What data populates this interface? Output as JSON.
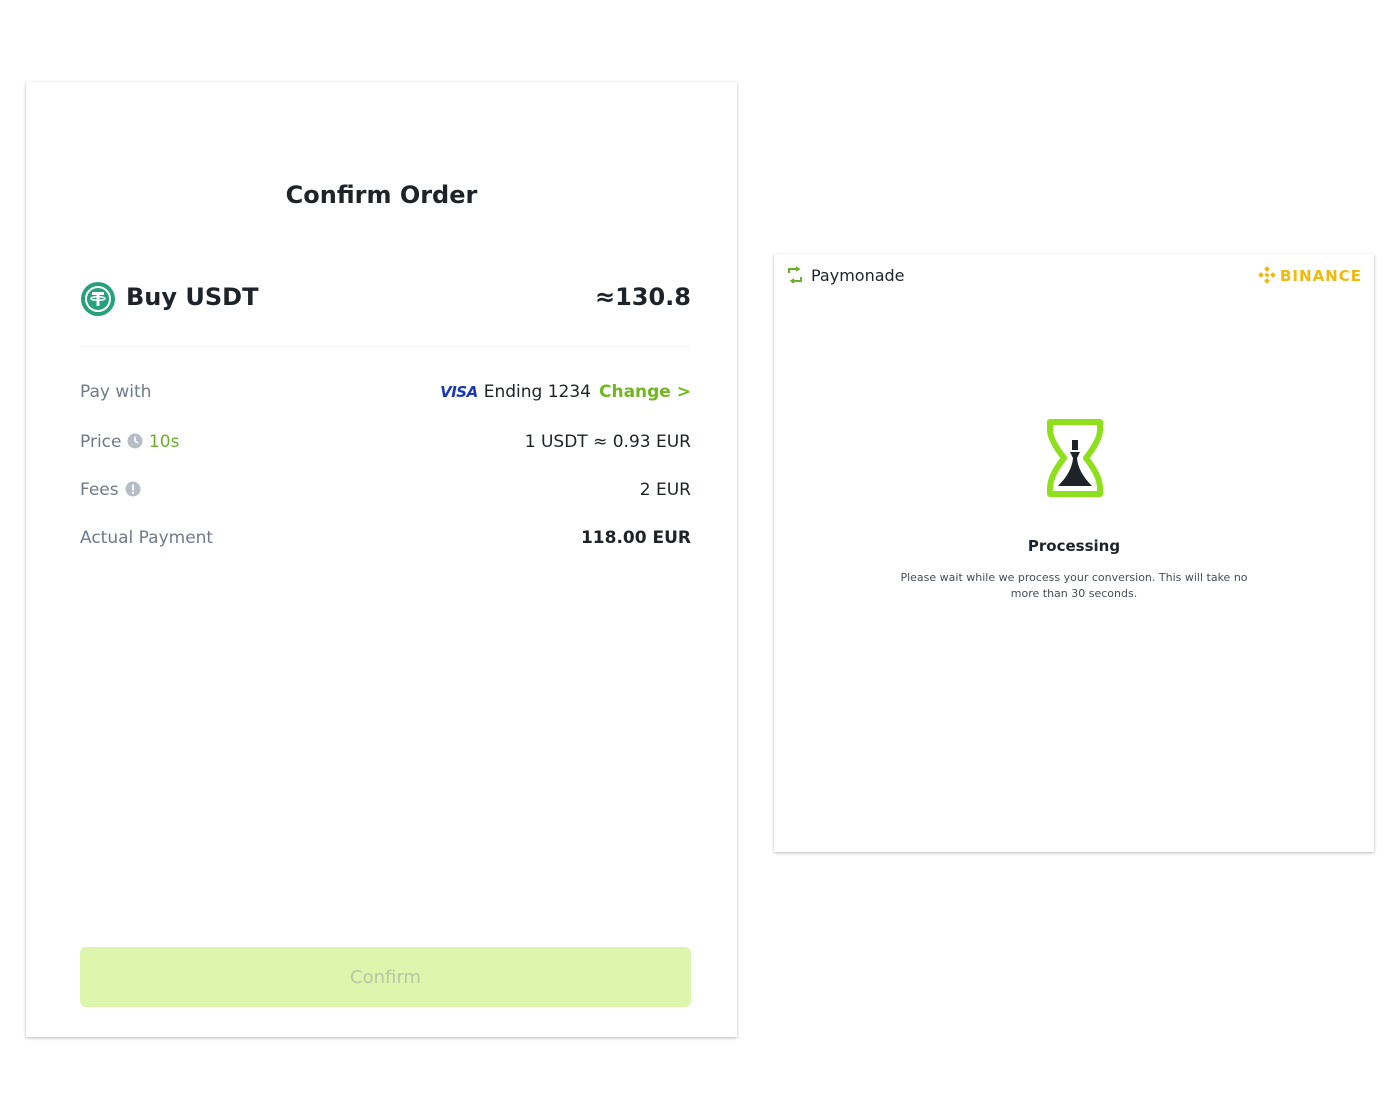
{
  "confirm_order": {
    "title": "Confirm Order",
    "buy_label": "Buy USDT",
    "buy_amount": "≈130.8",
    "pay_with": {
      "label": "Pay with",
      "card_brand": "VISA",
      "card_text": "Ending 1234",
      "change_label": "Change >"
    },
    "price": {
      "label": "Price",
      "timer": "10s",
      "value": "1 USDT ≈ 0.93 EUR"
    },
    "fees": {
      "label": "Fees",
      "value": "2 EUR"
    },
    "actual_payment": {
      "label": "Actual Payment",
      "value": "118.00 EUR"
    },
    "confirm_button": "Confirm"
  },
  "processing": {
    "brand": "Paymonade",
    "partner": "BINANCE",
    "title": "Processing",
    "message": "Please wait while we process your conversion. This will take no more than 30 seconds."
  },
  "colors": {
    "accent_green": "#6ab02a",
    "button_disabled": "#ddf5ad",
    "tether": "#26a17b",
    "binance": "#f0b90b",
    "hourglass": "#8ee01c"
  },
  "icons": [
    "tether-icon",
    "visa-logo",
    "clock-icon",
    "info-icon",
    "paymonade-logo-icon",
    "binance-logo-icon",
    "hourglass-icon"
  ]
}
